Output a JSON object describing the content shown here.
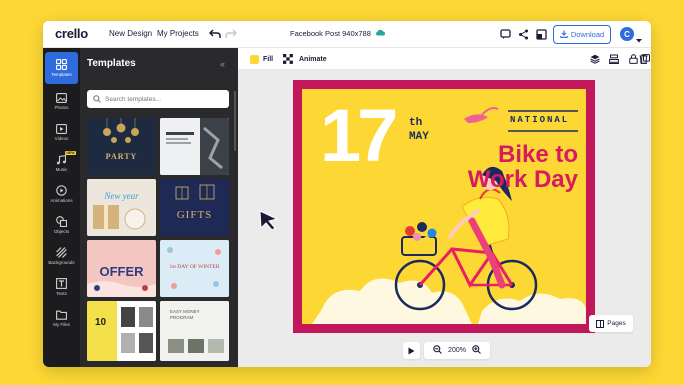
{
  "app": {
    "logo": "crello"
  },
  "topbar": {
    "menu": [
      "New Design",
      "My Projects"
    ],
    "doc_title": "Facebook Post 940x788",
    "download_label": "Download",
    "avatar_letter": "C"
  },
  "rail": {
    "items": [
      {
        "label": "Templates",
        "icon": "templates-icon",
        "active": true
      },
      {
        "label": "Photos",
        "icon": "photos-icon"
      },
      {
        "label": "Videos",
        "icon": "videos-icon"
      },
      {
        "label": "Music",
        "icon": "music-icon",
        "badge": "NEW"
      },
      {
        "label": "Animations",
        "icon": "animations-icon"
      },
      {
        "label": "Objects",
        "icon": "objects-icon"
      },
      {
        "label": "Backgrounds",
        "icon": "backgrounds-icon"
      },
      {
        "label": "Texts",
        "icon": "texts-icon"
      },
      {
        "label": "My Files",
        "icon": "folder-icon"
      }
    ]
  },
  "panel": {
    "title": "Templates",
    "collapse": "«",
    "search_placeholder": "Search templates...",
    "thumbs": [
      {
        "text": "PARTY",
        "bg": "#1d2a3f",
        "fg": "#d8b56a"
      },
      {
        "text": "",
        "bg": "#e9ecef",
        "fg": "#333"
      },
      {
        "text": "New year",
        "bg": "#e9e4dc",
        "fg": "#3aa0d8"
      },
      {
        "text": "GIFTS",
        "bg": "#1e2a55",
        "fg": "#d8b56a"
      },
      {
        "text": "OFFER",
        "bg": "#f2c1c1",
        "fg": "#2f3c82"
      },
      {
        "text": "1st DAY OF WINTER",
        "bg": "#dcecf6",
        "fg": "#c23c3c"
      },
      {
        "text": "10",
        "bg": "#f4e04a",
        "fg": "#222"
      },
      {
        "text": "EASY MONEY PROGRAM",
        "bg": "#efefef",
        "fg": "#555"
      }
    ]
  },
  "propbar": {
    "fill_label": "Fill",
    "animate_label": "Animate"
  },
  "design": {
    "day": "17",
    "suffix": "th",
    "month": "MAY",
    "national": "NATIONAL",
    "line1": "Bike to",
    "line2": "Work Day",
    "colors": {
      "border": "#C2185B",
      "background": "#FDD835",
      "title": "#D81B60",
      "accent": "#1b2a5c"
    }
  },
  "controls": {
    "zoom": "200%",
    "pages_label": "Pages"
  }
}
